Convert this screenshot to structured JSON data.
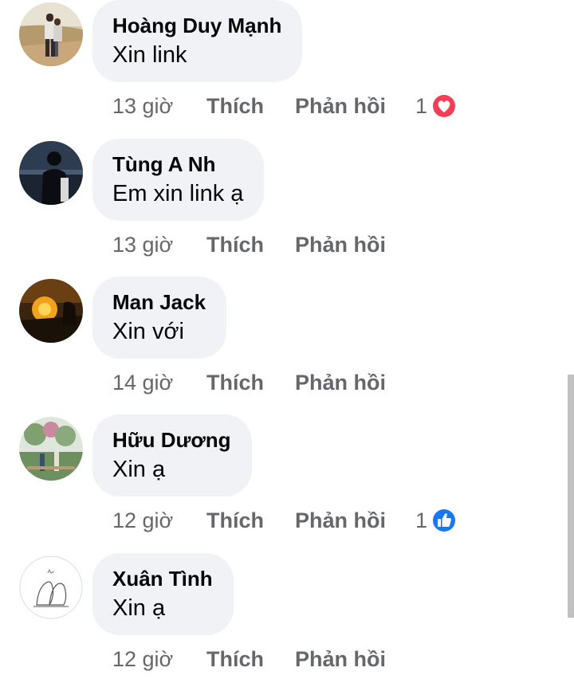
{
  "comments": [
    {
      "author": "Hoàng Duy Mạnh",
      "text": "Xin link",
      "time": "13 giờ",
      "like_label": "Thích",
      "reply_label": "Phản hồi",
      "reaction_count": "1",
      "reaction_icon": "love-reaction-icon"
    },
    {
      "author": "Tùng A Nh",
      "text": "Em xin link ạ",
      "time": "13 giờ",
      "like_label": "Thích",
      "reply_label": "Phản hồi"
    },
    {
      "author": "Man Jack",
      "text": "Xin với",
      "time": "14 giờ",
      "like_label": "Thích",
      "reply_label": "Phản hồi"
    },
    {
      "author": "Hữu Dương",
      "text": "Xin ạ",
      "time": "12 giờ",
      "like_label": "Thích",
      "reply_label": "Phản hồi",
      "reaction_count": "1",
      "reaction_icon": "like-reaction-icon"
    },
    {
      "author": "Xuân Tình",
      "text": "Xin ạ",
      "time": "12 giờ",
      "like_label": "Thích",
      "reply_label": "Phản hồi"
    }
  ],
  "colors": {
    "bubble": "#f0f2f5",
    "meta_text": "#65676b",
    "love_red": "#f33e58",
    "like_blue": "#1877f2"
  }
}
